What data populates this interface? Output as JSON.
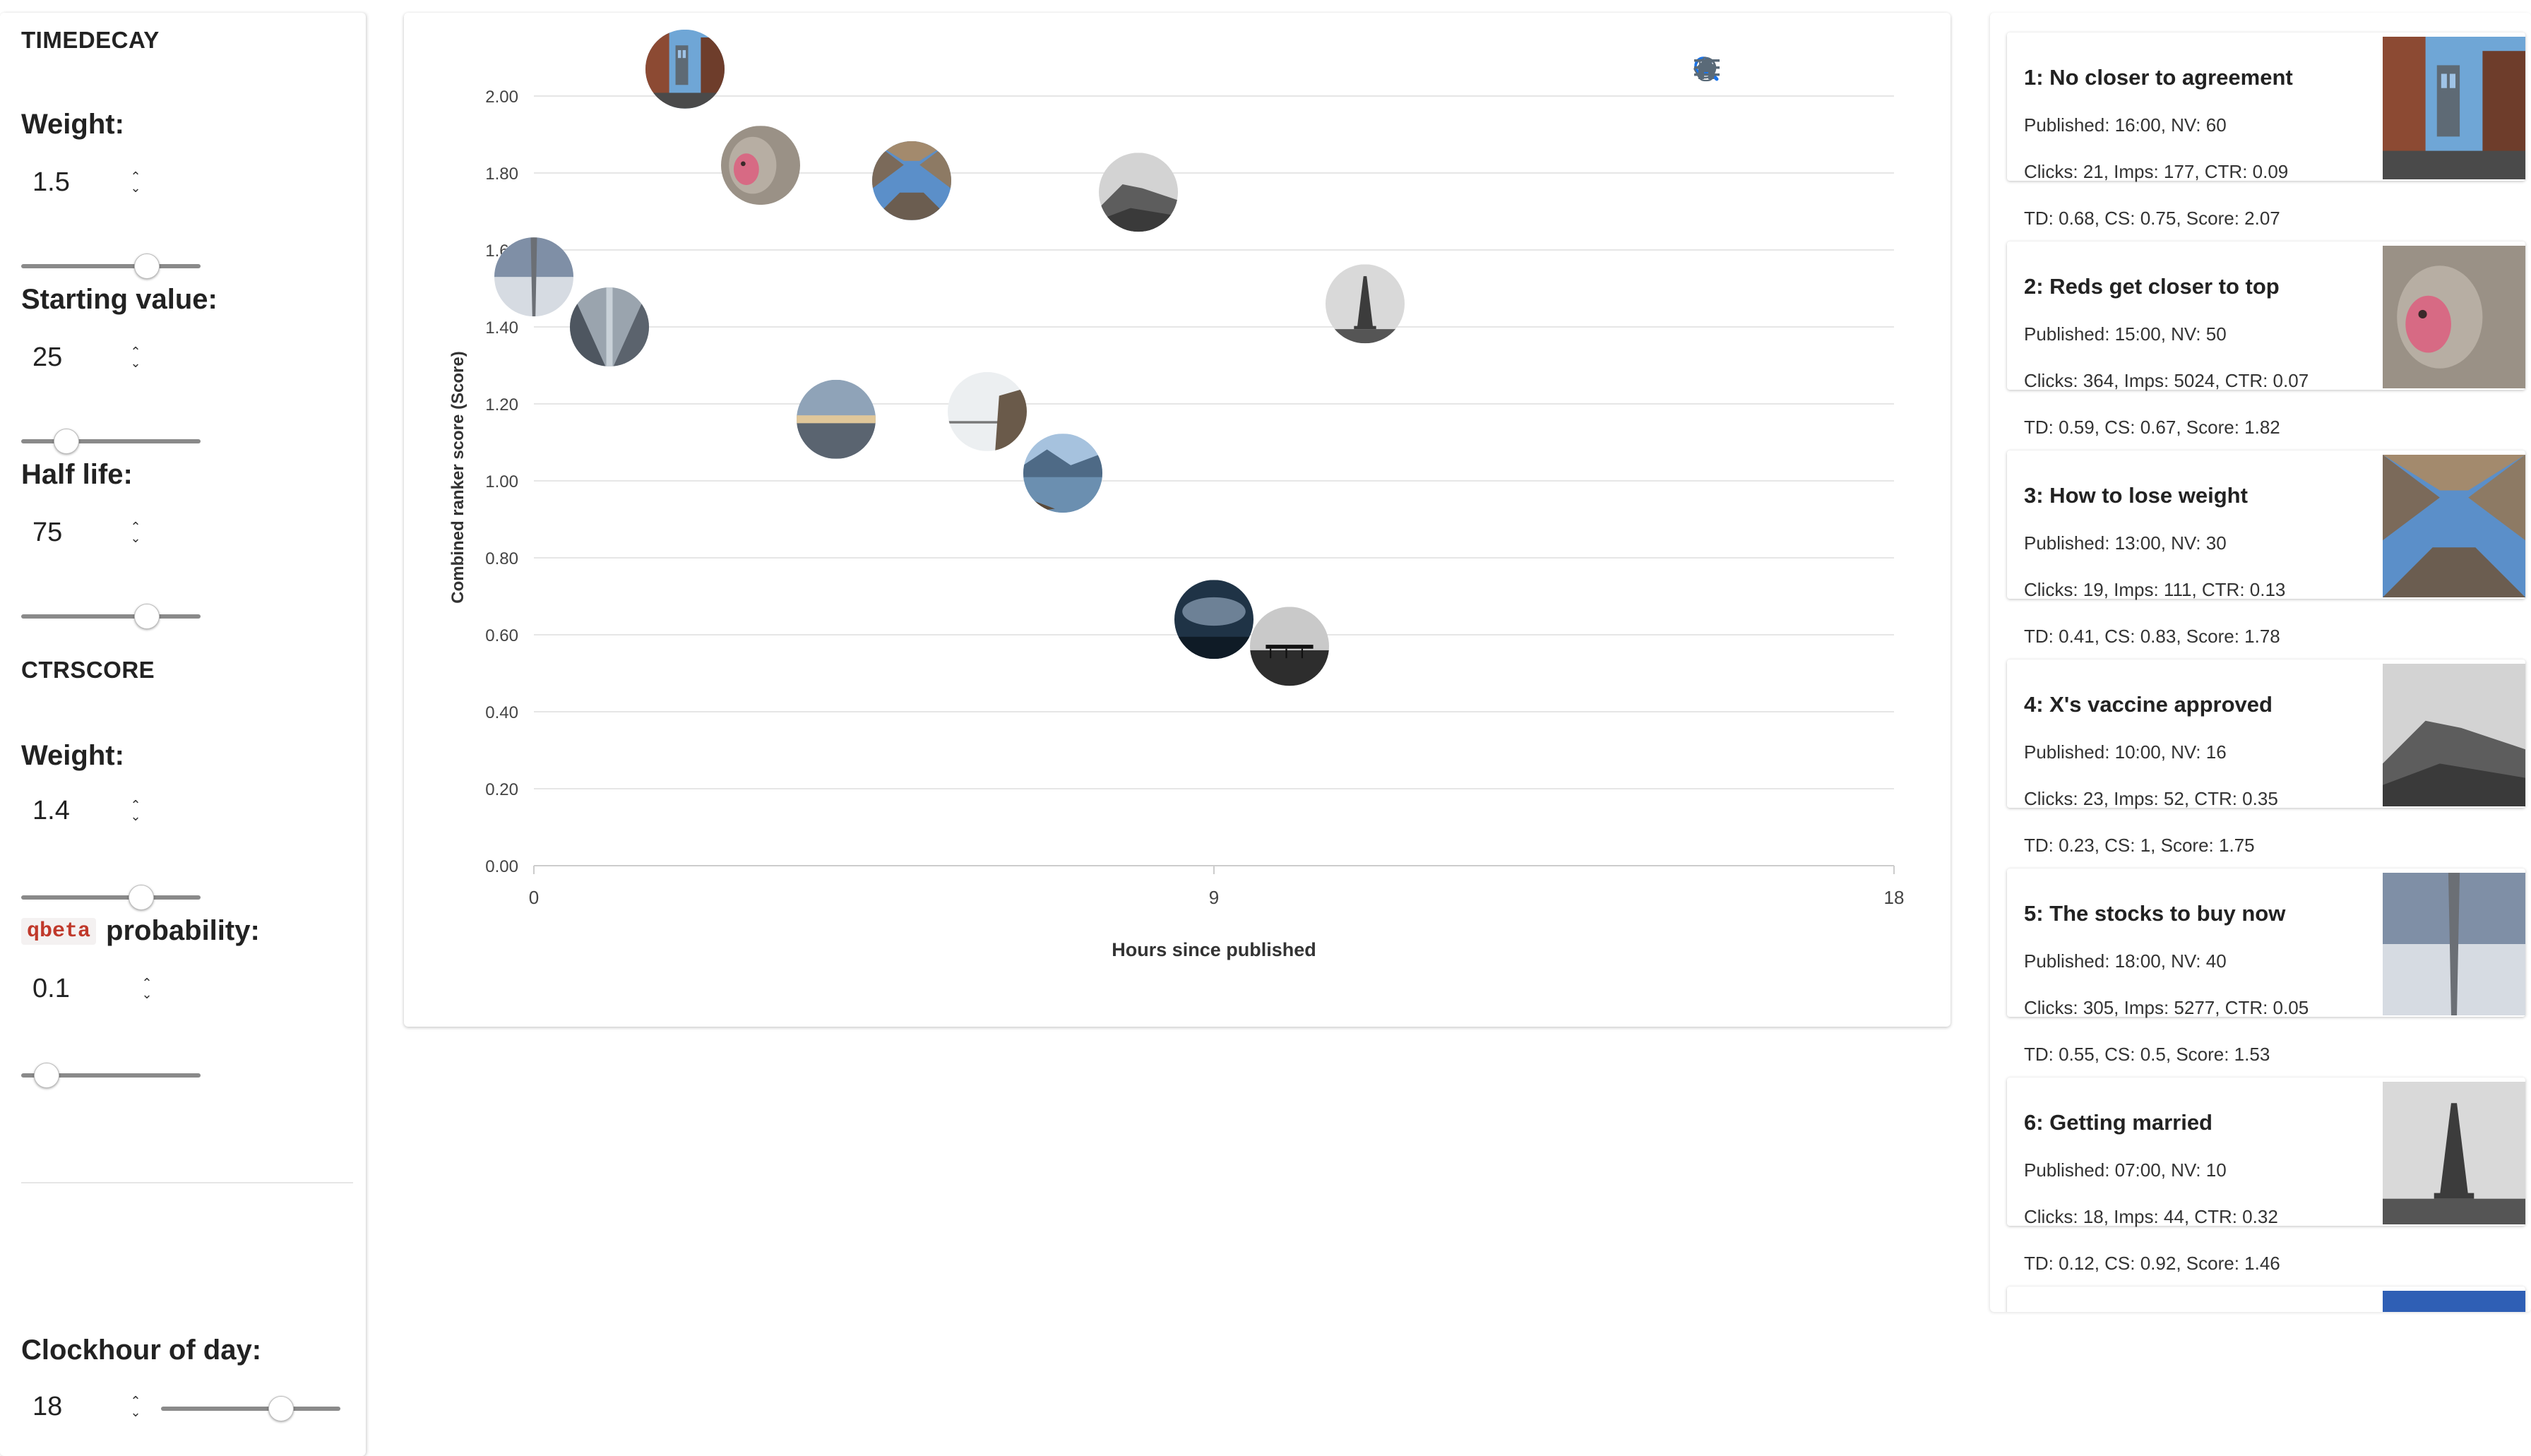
{
  "left": {
    "timedecay_title": "TIMEDECAY",
    "weight_label": "Weight:",
    "weight_value": "1.5",
    "weight_slider": 0.7,
    "starting_label": "Starting value:",
    "starting_value": "25",
    "starting_slider": 0.25,
    "halflife_label": "Half life:",
    "halflife_value": "75",
    "halflife_slider": 0.7,
    "ctr_title": "CTRSCORE",
    "ctr_weight_label": "Weight:",
    "ctr_weight_value": "1.4",
    "ctr_weight_slider": 0.67,
    "qbeta_token": "qbeta",
    "probability_label": "probability:",
    "probability_value": "0.1",
    "probability_slider": 0.14,
    "clock_label": "Clockhour of day:",
    "clock_value": "18",
    "clock_slider": 0.67
  },
  "chart_data": {
    "type": "scatter",
    "title": "",
    "xlabel": "Hours since published",
    "ylabel": "Combined ranker score (Score)",
    "xlim": [
      0,
      18
    ],
    "ylim": [
      0,
      2.1
    ],
    "x_ticks": [
      "0",
      "9",
      "18"
    ],
    "y_ticks": [
      "0.00",
      "0.20",
      "0.40",
      "0.60",
      "0.80",
      "1.00",
      "1.20",
      "1.40",
      "1.60",
      "1.80",
      "2.00"
    ],
    "grid": true,
    "points": [
      {
        "x": 2.0,
        "y": 2.07,
        "image": "bridge-street"
      },
      {
        "x": 3.0,
        "y": 1.82,
        "image": "red-face-monkey"
      },
      {
        "x": 5.0,
        "y": 1.78,
        "image": "building-courtyard"
      },
      {
        "x": 8.0,
        "y": 1.75,
        "image": "hill-landscape"
      },
      {
        "x": 0.0,
        "y": 1.53,
        "image": "sky-tower"
      },
      {
        "x": 11.0,
        "y": 1.46,
        "image": "eiffel-tower"
      },
      {
        "x": 1.0,
        "y": 1.4,
        "image": "tall-buildings"
      },
      {
        "x": 4.0,
        "y": 1.16,
        "image": "beach-sunset"
      },
      {
        "x": 6.0,
        "y": 1.18,
        "image": "pier-fog"
      },
      {
        "x": 7.0,
        "y": 1.02,
        "image": "lake-mountains"
      },
      {
        "x": 9.0,
        "y": 0.64,
        "image": "storm-clouds"
      },
      {
        "x": 10.0,
        "y": 0.57,
        "image": "pier-bw"
      }
    ]
  },
  "toolbar": {
    "icons": [
      "zoom-in-icon",
      "zoom-out-icon",
      "selection-zoom-icon",
      "pan-hand-icon",
      "reset-home-icon",
      "menu-icon"
    ]
  },
  "articles": [
    {
      "title": "1: No closer to agreement",
      "published": "Published: 16:00, NV: 60",
      "clicks": "Clicks: 21, Imps: 177, CTR: 0.09",
      "stats": "TD: 0.68, CS: 0.75, Score: 2.07",
      "image": "bridge-street"
    },
    {
      "title": "2: Reds get closer to top",
      "published": "Published: 15:00, NV: 50",
      "clicks": "Clicks: 364, Imps: 5024, CTR: 0.07",
      "stats": "TD: 0.59, CS: 0.67, Score: 1.82",
      "image": "red-face-monkey"
    },
    {
      "title": "3: How to lose weight",
      "published": "Published: 13:00, NV: 30",
      "clicks": "Clicks: 19, Imps: 111, CTR: 0.13",
      "stats": "TD: 0.41, CS: 0.83, Score: 1.78",
      "image": "building-courtyard"
    },
    {
      "title": "4: X's vaccine approved",
      "published": "Published: 10:00, NV: 16",
      "clicks": "Clicks: 23, Imps: 52, CTR: 0.35",
      "stats": "TD: 0.23, CS: 1, Score: 1.75",
      "image": "hill-landscape"
    },
    {
      "title": "5: The stocks to buy now",
      "published": "Published: 18:00, NV: 40",
      "clicks": "Clicks: 305, Imps: 5277, CTR: 0.05",
      "stats": "TD: 0.55, CS: 0.5, Score: 1.53",
      "image": "sky-tower"
    },
    {
      "title": "6: Getting married",
      "published": "Published: 07:00, NV: 10",
      "clicks": "Clicks: 18, Imps: 44, CTR: 0.32",
      "stats": "TD: 0.12, CS: 0.92, Score: 1.46",
      "image": "eiffel-tower"
    }
  ]
}
